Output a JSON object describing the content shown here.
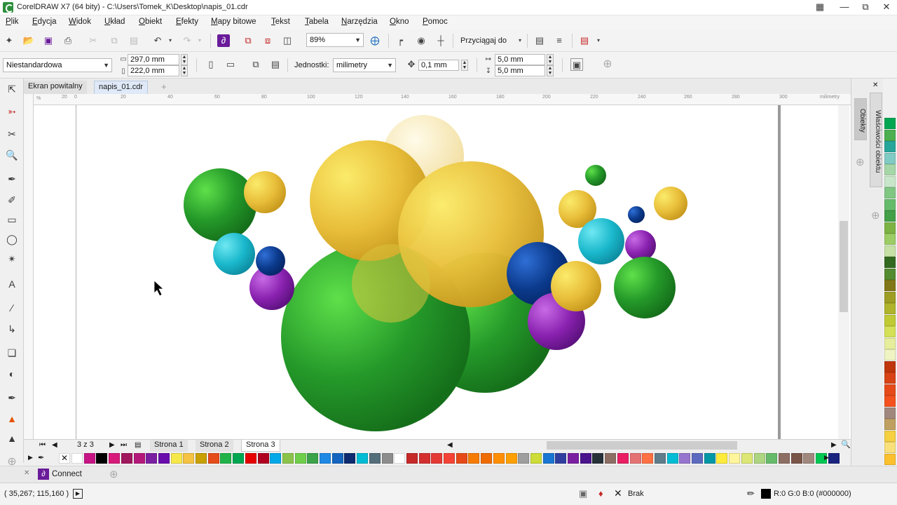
{
  "window": {
    "title": "CorelDRAW X7 (64 bity) - C:\\Users\\Tomek_K\\Desktop\\napis_01.cdr"
  },
  "menu": [
    "Plik",
    "Edycja",
    "Widok",
    "Układ",
    "Obiekt",
    "Efekty",
    "Mapy bitowe",
    "Tekst",
    "Tabela",
    "Narzędzia",
    "Okno",
    "Pomoc"
  ],
  "toolbar": {
    "zoom": "89%",
    "snap_label": "Przyciągaj do"
  },
  "property_bar": {
    "paper_preset": "Niestandardowa",
    "width": "297,0 mm",
    "height": "222,0 mm",
    "units_label": "Jednostki:",
    "units": "milimetry",
    "nudge": "0,1 mm",
    "dup_x": "5,0 mm",
    "dup_y": "5,0 mm"
  },
  "doc_tabs": [
    "Ekran powitalny",
    "napis_01.cdr"
  ],
  "ruler": {
    "h_labels": [
      "20",
      "0",
      "20",
      "40",
      "60",
      "80",
      "100",
      "120",
      "140",
      "160",
      "180",
      "200",
      "220",
      "240",
      "260",
      "280",
      "300"
    ],
    "h_unit": "milimetry"
  },
  "page_nav": {
    "counter": "3 z 3",
    "pages": [
      "Strona 1",
      "Strona 2",
      "Strona 3"
    ],
    "active": "Strona 3"
  },
  "docker": {
    "tabs": [
      "Obiekty",
      "Właściwości obiektu"
    ]
  },
  "connect": {
    "label": "Connect"
  },
  "status": {
    "coords": "( 35,267; 115,160 )",
    "fill_label": "Brak",
    "outline_label": "R:0 G:0 B:0 (#000000)"
  },
  "colors": {
    "accent": "#6a1b9a",
    "green_dark": "#1e7d1e",
    "gold": "#e8c23a",
    "cyan": "#1fb5c8",
    "navy": "#0b3a8c",
    "purple": "#7b1fa2"
  },
  "palette_row": [
    "#ffffff",
    "#c71585",
    "#000000",
    "#d81b7a",
    "#a0185e",
    "#b4197a",
    "#7b1fa2",
    "#6a0dad",
    "#f7e84a",
    "#f5c242",
    "#c8a000",
    "#e64c1a",
    "#21b34a",
    "#00a651",
    "#e60000",
    "#b00020",
    "#00a8e8",
    "#8bc34a",
    "#6fcf4a",
    "#3ba34a",
    "#1e88e5",
    "#1565c0",
    "#0d2b6e",
    "#00bcd4",
    "#546e7a",
    "#8d8d8d",
    "#ffffff",
    "#c62828",
    "#d32f2f",
    "#e53935",
    "#f44336",
    "#e64a19",
    "#f57c00",
    "#ef6c00",
    "#ff8f00",
    "#ffa000",
    "#9e9e9e",
    "#cddc39",
    "#1976d2",
    "#303f9f",
    "#7b1fa2",
    "#4a148c",
    "#263238",
    "#8d6e63",
    "#e91e63",
    "#e57373",
    "#ff7043",
    "#607d8b",
    "#00bcd4",
    "#9575cd",
    "#5c6bc0",
    "#0097a7",
    "#ffeb3b",
    "#fff59d",
    "#dce775",
    "#aed581",
    "#66bb6a",
    "#8d6e63",
    "#795548",
    "#a1887f",
    "#00c853",
    "#1a237e"
  ],
  "palette_right": [
    "#00a651",
    "#4caf50",
    "#26a69a",
    "#80cbc4",
    "#a5d6a7",
    "#c8e6c9",
    "#81c784",
    "#66bb6a",
    "#43a047",
    "#7cb342",
    "#9ccc65",
    "#c5e1a5",
    "#33691e",
    "#558b2f",
    "#827717",
    "#9e9d24",
    "#afb42b",
    "#c0ca33",
    "#d4e157",
    "#e6ee9c",
    "#f0f4c3",
    "#bf360c",
    "#d84315",
    "#e64a19",
    "#f4511e",
    "#a1887f",
    "#c0a060",
    "#f5d040",
    "#f9e07a",
    "#fbc02d"
  ]
}
